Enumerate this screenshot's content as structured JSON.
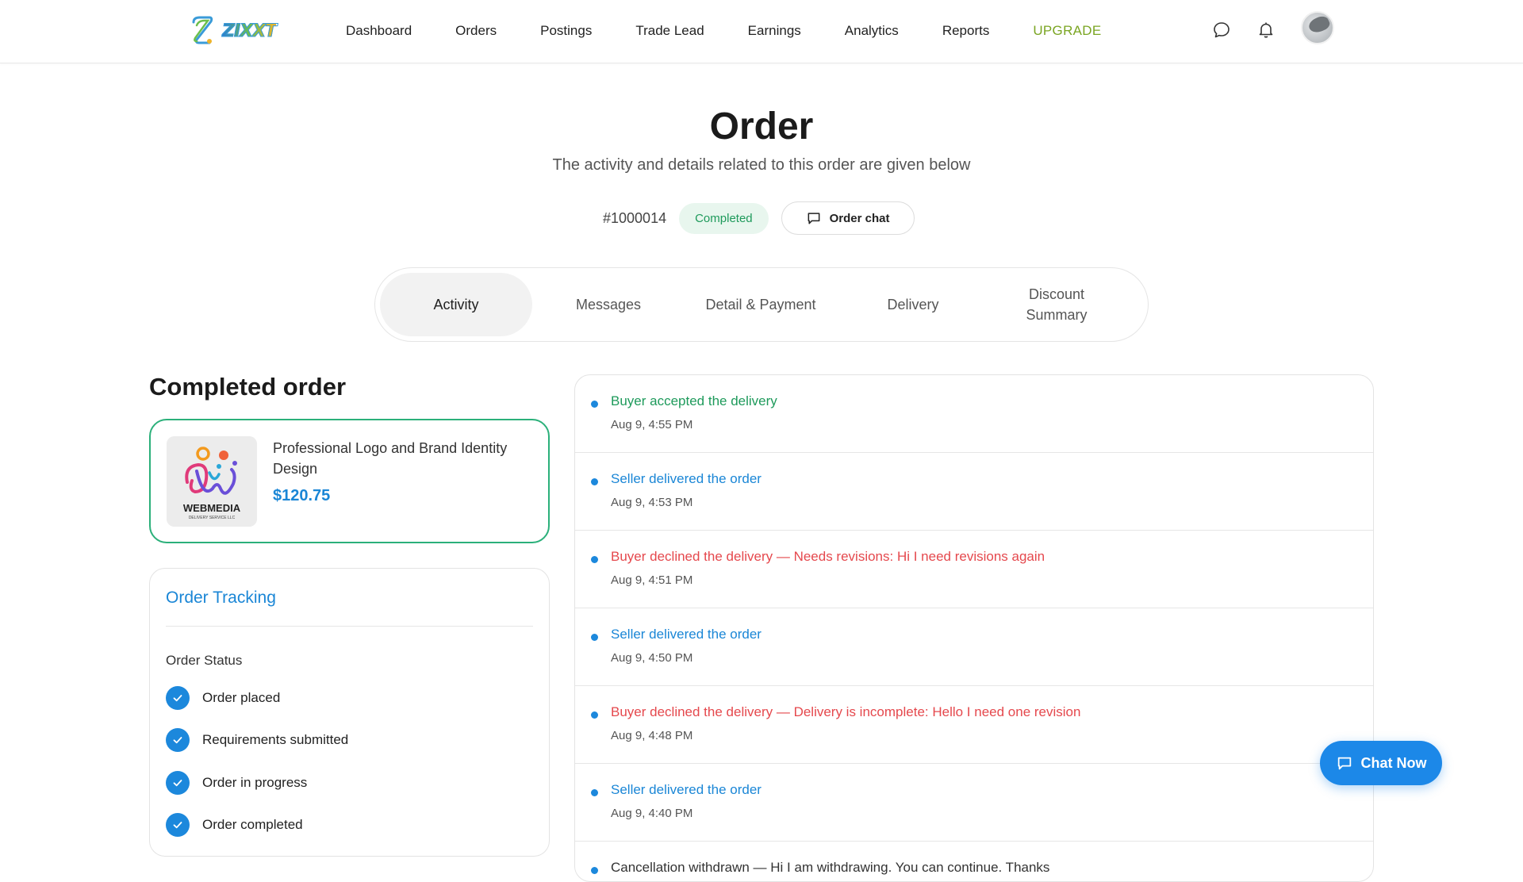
{
  "header": {
    "brand": "ZIXXT",
    "nav": [
      "Dashboard",
      "Orders",
      "Postings",
      "Trade Lead",
      "Earnings",
      "Analytics",
      "Reports",
      "UPGRADE"
    ],
    "icons": [
      "chat-bubble-icon",
      "bell-icon"
    ],
    "colors": {
      "upgrade": "#7aa522"
    }
  },
  "page": {
    "title": "Order",
    "subtitle": "The activity and details related to this order are given below",
    "order_id": "#1000014",
    "status": "Completed",
    "order_chat_label": "Order chat"
  },
  "tabs": [
    "Activity",
    "Messages",
    "Detail & Payment",
    "Delivery",
    "Discount Summary"
  ],
  "active_tab": "Activity",
  "completed": {
    "title": "Completed order",
    "product_name": "Professional Logo and Brand Identity Design",
    "price": "$120.75",
    "thumb_brand": "WEBMEDIA",
    "thumb_tagline": "DELIVERY SERVICE LLC"
  },
  "tracking": {
    "title": "Order Tracking",
    "status_label": "Order Status",
    "steps": [
      "Order placed",
      "Requirements submitted",
      "Order in progress",
      "Order completed"
    ]
  },
  "activity": [
    {
      "text": "Buyer accepted the delivery",
      "time": "Aug 9, 4:55 PM",
      "tone": "green"
    },
    {
      "text": "Seller delivered the order",
      "time": "Aug 9, 4:53 PM",
      "tone": "blue"
    },
    {
      "text": "Buyer declined the delivery — Needs revisions: Hi I need revisions again",
      "time": "Aug 9, 4:51 PM",
      "tone": "red"
    },
    {
      "text": "Seller delivered the order",
      "time": "Aug 9, 4:50 PM",
      "tone": "blue"
    },
    {
      "text": "Buyer declined the delivery — Delivery is incomplete: Hello I need one revision",
      "time": "Aug 9, 4:48 PM",
      "tone": "red"
    },
    {
      "text": "Seller delivered the order",
      "time": "Aug 9, 4:40 PM",
      "tone": "blue"
    },
    {
      "text": "Cancellation withdrawn — Hi I am withdrawing. You can continue. Thanks",
      "time": "",
      "tone": "dark"
    }
  ],
  "chat_now": "Chat Now"
}
